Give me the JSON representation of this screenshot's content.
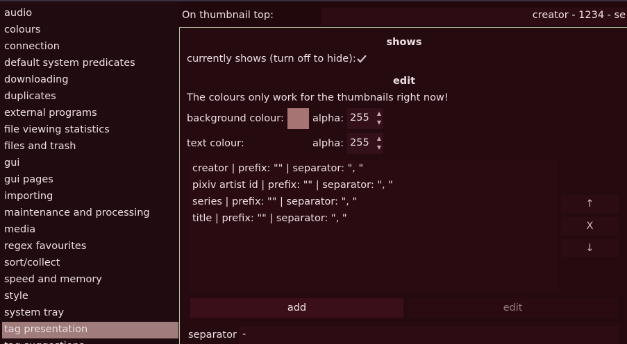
{
  "sidebar": {
    "items": [
      {
        "label": "audio"
      },
      {
        "label": "colours"
      },
      {
        "label": "connection"
      },
      {
        "label": "default system predicates"
      },
      {
        "label": "downloading"
      },
      {
        "label": "duplicates"
      },
      {
        "label": "external programs"
      },
      {
        "label": "file viewing statistics"
      },
      {
        "label": "files and trash"
      },
      {
        "label": "gui"
      },
      {
        "label": "gui pages"
      },
      {
        "label": "importing"
      },
      {
        "label": "maintenance and processing"
      },
      {
        "label": "media"
      },
      {
        "label": "regex favourites"
      },
      {
        "label": "sort/collect"
      },
      {
        "label": "speed and memory"
      },
      {
        "label": "style"
      },
      {
        "label": "system tray"
      },
      {
        "label": "tag presentation"
      },
      {
        "label": "tag suggestions"
      }
    ],
    "selected": "tag presentation"
  },
  "header": {
    "label": "On thumbnail top:",
    "value": "creator - 1234 - se"
  },
  "shows": {
    "title": "shows",
    "toggle_label": "currently shows (turn off to hide):",
    "checked": true
  },
  "edit": {
    "title": "edit",
    "note": "The colours only work for the thumbnails right now!",
    "background_label": "background colour:",
    "background_color": "#a77474",
    "alpha_label": "alpha:",
    "background_alpha": "255",
    "text_label": "text colour:",
    "text_alpha": "255",
    "entries": [
      {
        "text": "creator | prefix: \"\" | separator: \", \""
      },
      {
        "text": "pixiv artist id | prefix: \"\" | separator: \", \""
      },
      {
        "text": "series | prefix: \"\" | separator: \", \""
      },
      {
        "text": "title | prefix: \"\" | separator: \", \""
      }
    ],
    "move_up": "↑",
    "remove": "X",
    "move_down": "↓",
    "add_label": "add",
    "edit_label": "edit",
    "separator_label": "separator",
    "separator_value": "-"
  }
}
